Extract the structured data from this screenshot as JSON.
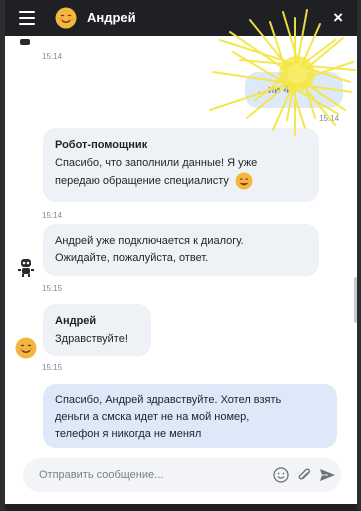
{
  "header": {
    "title": "Андрей",
    "close_label": "×"
  },
  "messages": {
    "t0": "15:14",
    "partial_user_text": "…ии 4",
    "t1": "15:14",
    "bot_sender": "Робот-помощник",
    "bot_line1": "Спасибо, что заполнили данные! Я уже",
    "bot_line2": "передаю обращение специалисту",
    "t2": "15:14",
    "sys_line1": "Андрей уже подключается к диалогу.",
    "sys_line2": "Ожидайте, пожалуйста, ответ.",
    "t3": "15:15",
    "agent_sender": "Андрей",
    "agent_text": "Здравствуйте!",
    "t4": "15:15",
    "user_line1": "Спасибо, Андрей здравствуйте. Хотел взять",
    "user_line2": "деньги а смска идет не на мой номер,",
    "user_line3": "телефон я никогда не менял"
  },
  "composer": {
    "placeholder": "Отправить сообщение..."
  },
  "icons": [
    "menu-icon",
    "avatar-emoji-icon",
    "close-icon",
    "robot-icon",
    "smile-emoji-icon",
    "emoji-icon",
    "attach-icon",
    "send-icon"
  ],
  "colors": {
    "header": "#1f2024",
    "bubble_bot": "#eef1f6",
    "bubble_user": "#dde9f8",
    "highlight": "#f5e642"
  }
}
